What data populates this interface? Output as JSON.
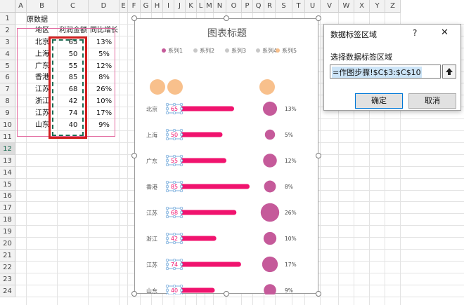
{
  "columns": [
    "A",
    "B",
    "C",
    "D",
    "E",
    "F",
    "G",
    "H",
    "I",
    "J",
    "K",
    "L",
    "M",
    "N",
    "O",
    "P",
    "Q",
    "R",
    "S",
    "T",
    "U",
    "V",
    "W",
    "X",
    "Y",
    "Z"
  ],
  "rows": [
    "1",
    "2",
    "3",
    "4",
    "5",
    "6",
    "7",
    "8",
    "9",
    "10",
    "11",
    "12",
    "13",
    "14",
    "15",
    "16",
    "17",
    "18",
    "19",
    "20",
    "21",
    "22",
    "23",
    "24"
  ],
  "sheet": {
    "title": "原数据",
    "headers": [
      "地区",
      "利润金额",
      "同比增长"
    ],
    "table": [
      [
        "北京",
        "65",
        "13%"
      ],
      [
        "上海",
        "50",
        "5%"
      ],
      [
        "广东",
        "55",
        "12%"
      ],
      [
        "香港",
        "85",
        "8%"
      ],
      [
        "江苏",
        "68",
        "26%"
      ],
      [
        "浙江",
        "42",
        "10%"
      ],
      [
        "江苏",
        "74",
        "17%"
      ],
      [
        "山东",
        "40",
        "9%"
      ]
    ]
  },
  "chart": {
    "title": "图表标题",
    "legend": [
      "系列1",
      "系列2",
      "系列3",
      "系列4",
      "系列5"
    ],
    "legend_colors": [
      "#c55a9a",
      "#c8c8c8",
      "#c8c8c8",
      "#c8c8c8",
      "#f8c08c"
    ],
    "bar_color": "#f0136e",
    "bubble_color": "#c55a9a",
    "header_bubble_color": "#f8c08c"
  },
  "chart_data": {
    "type": "bar",
    "categories": [
      "北京",
      "上海",
      "广东",
      "香港",
      "江苏",
      "浙江",
      "江苏",
      "山东"
    ],
    "series": [
      {
        "name": "系列1",
        "values": [
          65,
          50,
          55,
          85,
          68,
          42,
          74,
          40
        ]
      },
      {
        "name": "系列5",
        "values": [
          13,
          5,
          12,
          8,
          26,
          10,
          17,
          9
        ]
      }
    ],
    "bar_labels": [
      "65",
      "50",
      "55",
      "85",
      "68",
      "42",
      "74",
      "40"
    ],
    "bubble_labels": [
      "13%",
      "5%",
      "12%",
      "8%",
      "26%",
      "10%",
      "17%",
      "9%"
    ],
    "xlim": [
      0,
      100
    ],
    "title": "图表标题"
  },
  "dialog": {
    "title": "数据标签区域",
    "help": "?",
    "close": "✕",
    "prompt": "选择数据标签区域",
    "value": "=作图步骤!$C$3:$C$10",
    "ok": "确定",
    "cancel": "取消"
  }
}
